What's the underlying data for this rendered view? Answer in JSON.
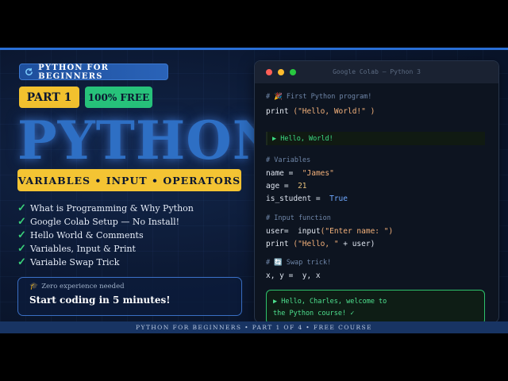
{
  "series_badge": "PYTHON FOR BEGINNERS",
  "part_badge": "PART 1",
  "free_badge": "100% FREE",
  "hero_title": "PYTHON",
  "topics_banner": "VARIABLES • INPUT • OPERATORS",
  "checklist": [
    "What is Programming & Why Python",
    "Google Colab Setup — No Install!",
    "Hello World & Comments",
    "Variables, Input & Print",
    "Variable Swap Trick"
  ],
  "cta": {
    "subtitle": "Zero experience needed",
    "title": "Start coding in 5 minutes!"
  },
  "editor": {
    "title": "Google Colab — Python 3",
    "comment1": "# 🎉 First Python program!",
    "print1_fn": "print",
    "print1_str": "(\"Hello, World!\" )",
    "output1": "▶ Hello, World!",
    "comment2": "# Variables",
    "name_lhs": "name = ",
    "name_val": "\"James\"",
    "age_lhs": "age = ",
    "age_val": "21",
    "student_lhs": "is_student = ",
    "student_val": "True",
    "comment3": "# Input function",
    "user_lhs": "user= ",
    "user_fn": "input",
    "user_str": "(\"Enter name: \")",
    "print2_fn": "print",
    "print2_str": "(\"Hello, \"",
    "print2_rest": " + user)",
    "comment4": "# 🔄 Swap trick!",
    "swap": "x, y =  y, x",
    "output2_line1": "▶ Hello, Charles, welcome to",
    "output2_line2": "the Python course! ✓"
  },
  "footer": "PYTHON FOR BEGINNERS • PART 1 OF 4 • FREE COURSE",
  "colors": {
    "accent_blue": "#2e6fc4",
    "badge_yellow": "#f4c433",
    "badge_green": "#27c27a",
    "output_green": "#3ddc84"
  }
}
